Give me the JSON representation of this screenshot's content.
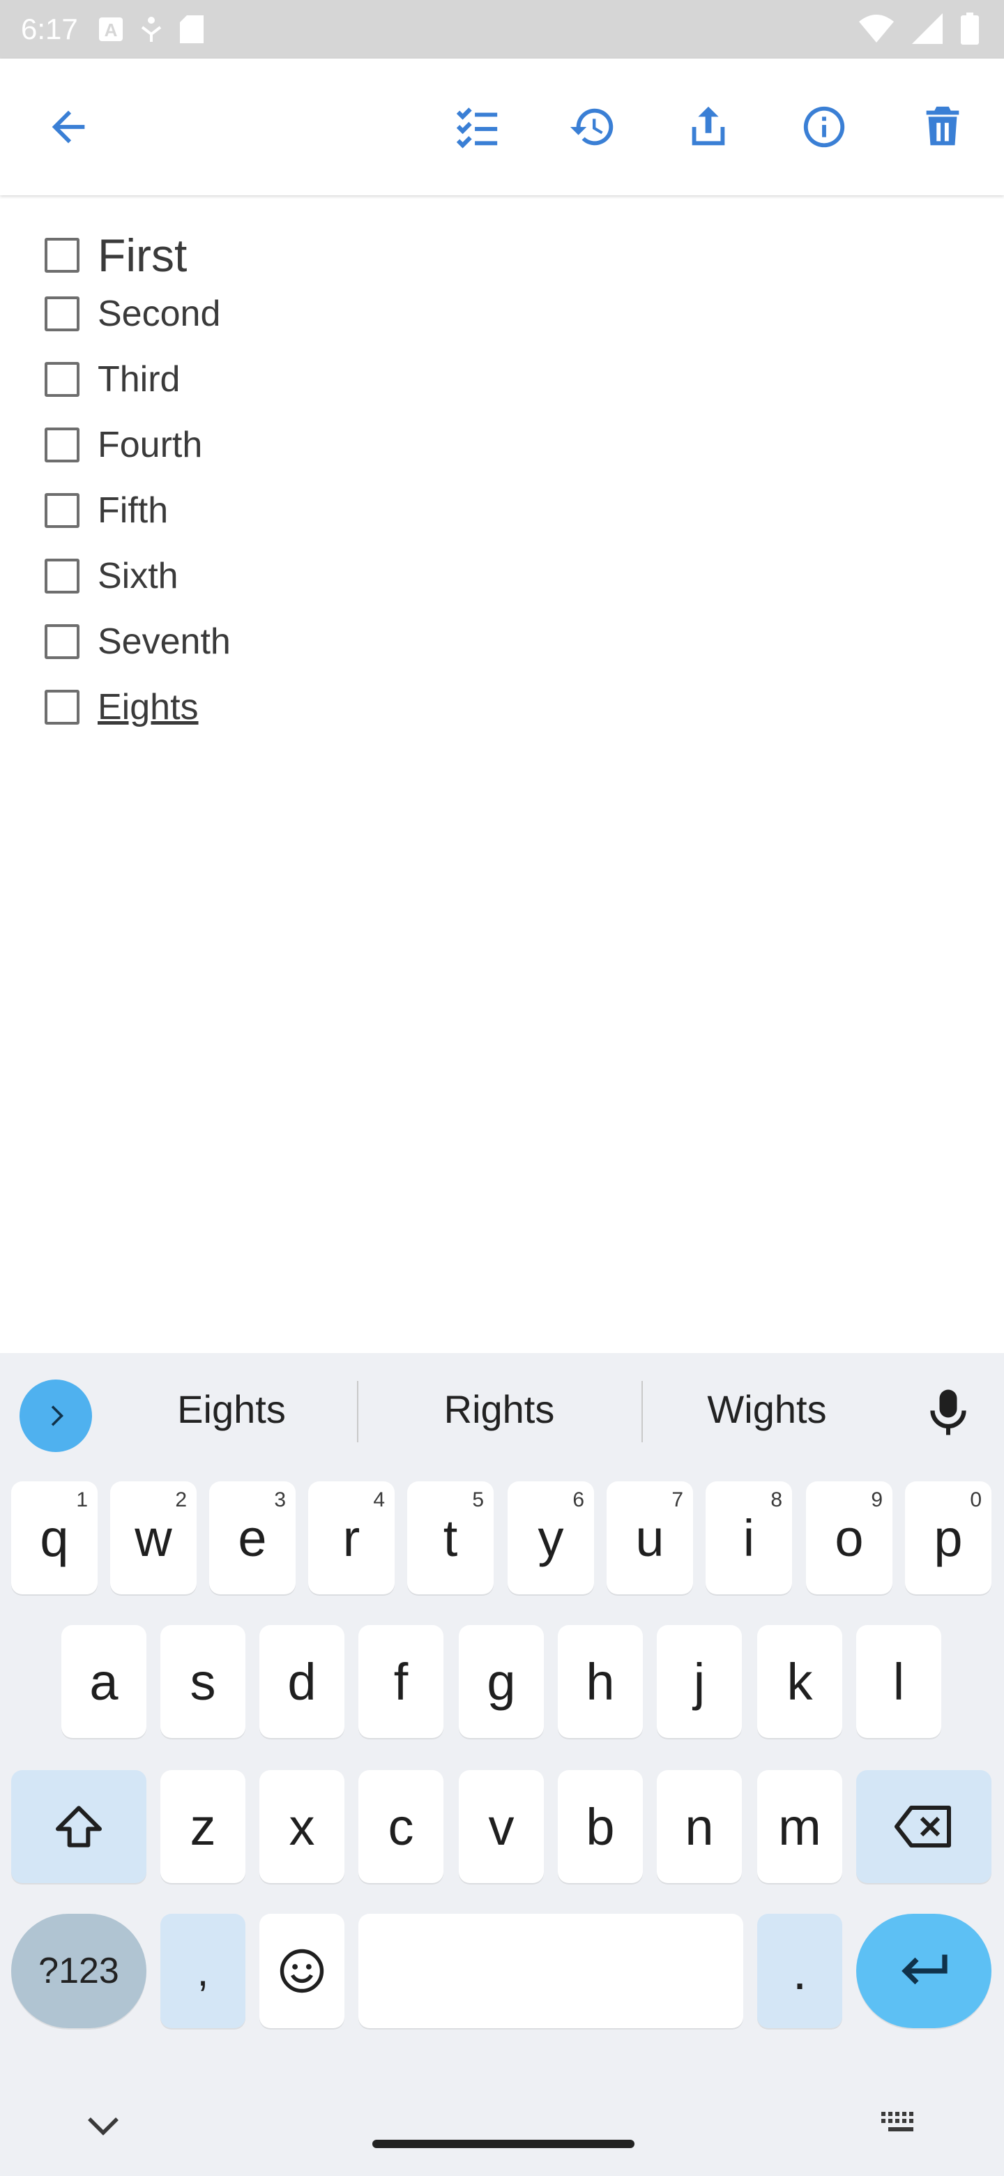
{
  "status_bar": {
    "time": "6:17",
    "icons": [
      "text-icon",
      "accessibility-icon",
      "sd-card-icon",
      "wifi-icon",
      "cellular-icon",
      "battery-icon"
    ]
  },
  "toolbar": {
    "icons": [
      "back-arrow-icon",
      "checklist-icon",
      "history-icon",
      "share-icon",
      "info-icon",
      "delete-icon"
    ],
    "accent_color": "#3a7fd5"
  },
  "checklist": {
    "items": [
      {
        "label": "First",
        "checked": false
      },
      {
        "label": "Second",
        "checked": false
      },
      {
        "label": "Third",
        "checked": false
      },
      {
        "label": "Fourth",
        "checked": false
      },
      {
        "label": "Fifth",
        "checked": false
      },
      {
        "label": "Sixth",
        "checked": false
      },
      {
        "label": "Seventh",
        "checked": false
      },
      {
        "label": "Eights",
        "checked": false
      }
    ]
  },
  "keyboard": {
    "suggestions": [
      "Eights",
      "Rights",
      "Wights"
    ],
    "row1": [
      {
        "key": "q",
        "num": "1"
      },
      {
        "key": "w",
        "num": "2"
      },
      {
        "key": "e",
        "num": "3"
      },
      {
        "key": "r",
        "num": "4"
      },
      {
        "key": "t",
        "num": "5"
      },
      {
        "key": "y",
        "num": "6"
      },
      {
        "key": "u",
        "num": "7"
      },
      {
        "key": "i",
        "num": "8"
      },
      {
        "key": "o",
        "num": "9"
      },
      {
        "key": "p",
        "num": "0"
      }
    ],
    "row2": [
      "a",
      "s",
      "d",
      "f",
      "g",
      "h",
      "j",
      "k",
      "l"
    ],
    "row3": [
      "z",
      "x",
      "c",
      "v",
      "b",
      "n",
      "m"
    ],
    "symbols_key": "?123",
    "comma_key": ",",
    "period_key": "."
  }
}
